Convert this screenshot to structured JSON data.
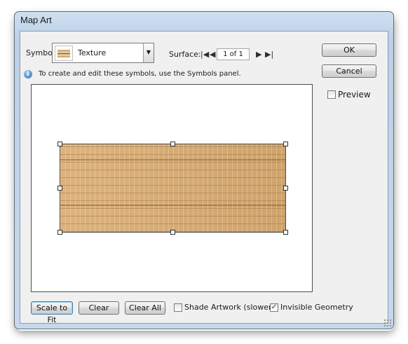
{
  "window": {
    "title": "Map Art"
  },
  "symbol": {
    "label": "Symbol:",
    "value": "Texture"
  },
  "surface": {
    "label": "Surface:",
    "page": "1 of 1"
  },
  "info": {
    "text": "To create and edit these symbols, use the Symbols panel."
  },
  "buttons": {
    "ok": "OK",
    "cancel": "Cancel",
    "scale_to_fit": "Scale to Fit",
    "clear": "Clear",
    "clear_all": "Clear All"
  },
  "checkboxes": {
    "preview": {
      "label": "Preview",
      "checked": false
    },
    "shade_artwork": {
      "label": "Shade Artwork (slower)",
      "checked": false
    },
    "invisible_geometry": {
      "label": "Invisible Geometry",
      "checked": true
    }
  },
  "icons": [
    "info-icon",
    "first-surface-icon",
    "previous-surface-icon",
    "next-surface-icon",
    "last-surface-icon",
    "dropdown-arrow-icon",
    "resize-grip-icon"
  ],
  "colors": {
    "texture": "#d9ac73",
    "title_bar": "#cfdff0",
    "focus_border": "#3c7fb1"
  }
}
